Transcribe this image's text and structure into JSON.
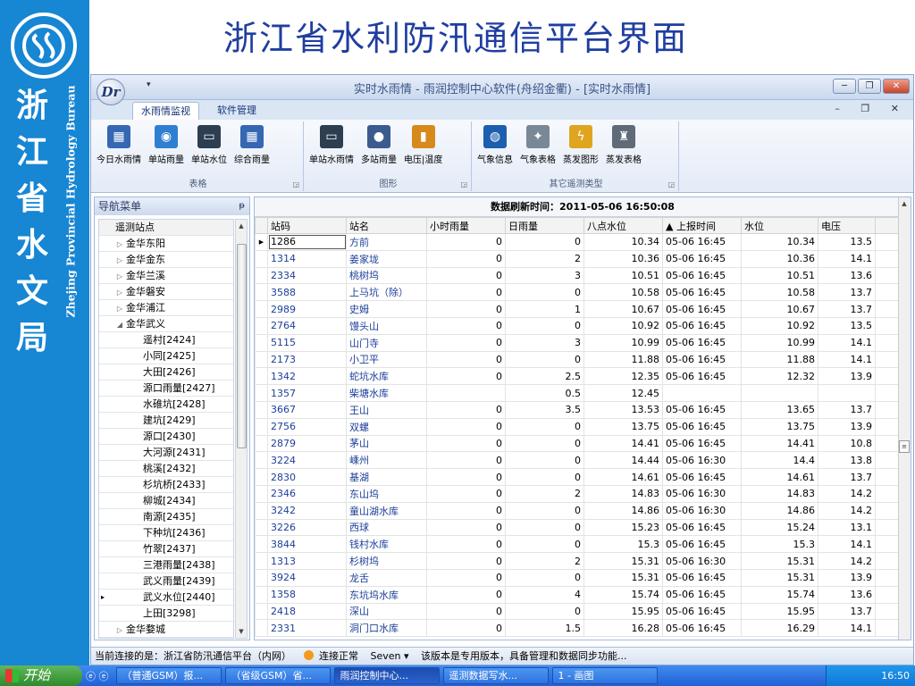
{
  "slide": {
    "title": "浙江省水利防汛通信平台界面",
    "org_cn": [
      "浙",
      "江",
      "省",
      "水",
      "文",
      "局"
    ],
    "org_en": "Zhejing Provincial Hydrology Bureau"
  },
  "window": {
    "title": "实时水雨情 - 雨润控制中心软件(舟绍金衢) - [实时水雨情]",
    "app_icon_text": "Dr",
    "qat": "▾",
    "btn_min": "─",
    "btn_max": "❐",
    "btn_close": "✕"
  },
  "ribbon": {
    "tabs": [
      "水雨情监视",
      "软件管理"
    ],
    "mdi_buttons": "– ❐ ✕",
    "groups": [
      {
        "label": "表格",
        "buttons": [
          {
            "label": "今日水雨情",
            "icon": "grid-table-icon",
            "color": "#3567b3",
            "glyph": "▦"
          },
          {
            "label": "单站雨量",
            "icon": "rain-gauge-icon",
            "color": "#2f7fd1",
            "glyph": "◉"
          },
          {
            "label": "单站水位",
            "icon": "water-level-monitor-icon",
            "color": "#2c3e50",
            "glyph": "▭"
          },
          {
            "label": "综合雨量",
            "icon": "grid-table-icon",
            "color": "#3567b3",
            "glyph": "▦"
          }
        ]
      },
      {
        "label": "图形",
        "buttons": [
          {
            "label": "单站水雨情",
            "icon": "chart-monitor-icon",
            "color": "#2c3e50",
            "glyph": "▭"
          },
          {
            "label": "多站雨量",
            "icon": "globe-icon",
            "color": "#3b5b8f",
            "glyph": "●"
          },
          {
            "label": "电压|温度",
            "icon": "battery-icon",
            "color": "#d68a1c",
            "glyph": "▮"
          }
        ]
      },
      {
        "label": "其它遥测类型",
        "buttons": [
          {
            "label": "气象信息",
            "icon": "weather-globe-icon",
            "color": "#1c5fae",
            "glyph": "◍"
          },
          {
            "label": "气象表格",
            "icon": "weather-station-icon",
            "color": "#7a8796",
            "glyph": "✦"
          },
          {
            "label": "蒸发图形",
            "icon": "evaporation-lightning-icon",
            "color": "#e0a51f",
            "glyph": "ϟ"
          },
          {
            "label": "蒸发表格",
            "icon": "evaporation-gauge-icon",
            "color": "#5f6b78",
            "glyph": "♜"
          }
        ]
      }
    ]
  },
  "nav": {
    "title": "导航菜单",
    "pin": "ᵽ",
    "root": "遥测站点",
    "items": [
      {
        "label": "金华东阳",
        "level": 1,
        "expander": "▷"
      },
      {
        "label": "金华金东",
        "level": 1,
        "expander": "▷"
      },
      {
        "label": "金华兰溪",
        "level": 1,
        "expander": "▷"
      },
      {
        "label": "金华磐安",
        "level": 1,
        "expander": "▷"
      },
      {
        "label": "金华浦江",
        "level": 1,
        "expander": "▷"
      },
      {
        "label": "金华武义",
        "level": 1,
        "expander": "◢"
      },
      {
        "label": "遥村[2424]",
        "level": 2
      },
      {
        "label": "小同[2425]",
        "level": 2
      },
      {
        "label": "大田[2426]",
        "level": 2
      },
      {
        "label": "源口雨量[2427]",
        "level": 2
      },
      {
        "label": "水碓坑[2428]",
        "level": 2
      },
      {
        "label": "建坑[2429]",
        "level": 2
      },
      {
        "label": "源口[2430]",
        "level": 2
      },
      {
        "label": "大河源[2431]",
        "level": 2
      },
      {
        "label": "桃溪[2432]",
        "level": 2
      },
      {
        "label": "杉坑桥[2433]",
        "level": 2
      },
      {
        "label": "柳城[2434]",
        "level": 2
      },
      {
        "label": "南源[2435]",
        "level": 2
      },
      {
        "label": "下种坑[2436]",
        "level": 2
      },
      {
        "label": "竹翠[2437]",
        "level": 2
      },
      {
        "label": "三港雨量[2438]",
        "level": 2
      },
      {
        "label": "武义雨量[2439]",
        "level": 2
      },
      {
        "label": "武义水位[2440]",
        "level": 2,
        "marker": "▸"
      },
      {
        "label": "上田[3298]",
        "level": 2
      },
      {
        "label": "金华婺城",
        "level": 1,
        "expander": "▷"
      }
    ]
  },
  "grid": {
    "refresh_text": "数据刷新时间：2011-05-06 16:50:08",
    "columns": [
      "站码",
      "站名",
      "小时雨量",
      "日雨量",
      "八点水位",
      "▲  上报时间",
      "水位",
      "电压"
    ],
    "current_marker": "▶",
    "rows": [
      [
        "1286",
        "方前",
        "0",
        "0",
        "10.34",
        "05-06 16:45",
        "10.34",
        "13.5"
      ],
      [
        "1314",
        "姜家垅",
        "0",
        "2",
        "10.36",
        "05-06 16:45",
        "10.36",
        "14.1"
      ],
      [
        "2334",
        "桃树坞",
        "0",
        "3",
        "10.51",
        "05-06 16:45",
        "10.51",
        "13.6"
      ],
      [
        "3588",
        "上马坑（除）",
        "0",
        "0",
        "10.58",
        "05-06 16:45",
        "10.58",
        "13.7"
      ],
      [
        "2989",
        "史姆",
        "0",
        "1",
        "10.67",
        "05-06 16:45",
        "10.67",
        "13.7"
      ],
      [
        "2764",
        "馒头山",
        "0",
        "0",
        "10.92",
        "05-06 16:45",
        "10.92",
        "13.5"
      ],
      [
        "5115",
        "山门寺",
        "0",
        "3",
        "10.99",
        "05-06 16:45",
        "10.99",
        "14.1"
      ],
      [
        "2173",
        "小卫平",
        "0",
        "0",
        "11.88",
        "05-06 16:45",
        "11.88",
        "14.1"
      ],
      [
        "1342",
        "蛇坑水库",
        "0",
        "2.5",
        "12.35",
        "05-06 16:45",
        "12.32",
        "13.9"
      ],
      [
        "1357",
        "柴塘水库",
        "",
        "0.5",
        "12.45",
        "",
        "",
        ""
      ],
      [
        "3667",
        "王山",
        "0",
        "3.5",
        "13.53",
        "05-06 16:45",
        "13.65",
        "13.7"
      ],
      [
        "2756",
        "双螺",
        "0",
        "0",
        "13.75",
        "05-06 16:45",
        "13.75",
        "13.9"
      ],
      [
        "2879",
        "茅山",
        "0",
        "0",
        "14.41",
        "05-06 16:45",
        "14.41",
        "10.8"
      ],
      [
        "3224",
        "嵊州",
        "0",
        "0",
        "14.44",
        "05-06 16:30",
        "14.4",
        "13.8"
      ],
      [
        "2830",
        "基湖",
        "0",
        "0",
        "14.61",
        "05-06 16:45",
        "14.61",
        "13.7"
      ],
      [
        "2346",
        "东山坞",
        "0",
        "2",
        "14.83",
        "05-06 16:30",
        "14.83",
        "14.2"
      ],
      [
        "3242",
        "童山湖水库",
        "0",
        "0",
        "14.86",
        "05-06 16:30",
        "14.86",
        "14.2"
      ],
      [
        "3226",
        "西球",
        "0",
        "0",
        "15.23",
        "05-06 16:45",
        "15.24",
        "13.1"
      ],
      [
        "3844",
        "钱村水库",
        "0",
        "0",
        "15.3",
        "05-06 16:45",
        "15.3",
        "14.1"
      ],
      [
        "1313",
        "杉树坞",
        "0",
        "2",
        "15.31",
        "05-06 16:30",
        "15.31",
        "14.2"
      ],
      [
        "3924",
        "龙舌",
        "0",
        "0",
        "15.31",
        "05-06 16:45",
        "15.31",
        "13.9"
      ],
      [
        "1358",
        "东坑坞水库",
        "0",
        "4",
        "15.74",
        "05-06 16:45",
        "15.74",
        "13.6"
      ],
      [
        "2418",
        "深山",
        "0",
        "0",
        "15.95",
        "05-06 16:45",
        "15.95",
        "13.7"
      ],
      [
        "2331",
        "洞门口水库",
        "0",
        "1.5",
        "16.28",
        "05-06 16:45",
        "16.29",
        "14.1"
      ]
    ]
  },
  "status": {
    "prefix": "当前连接的是：浙江省防汛通信平台（内网）",
    "connection": "连接正常",
    "user": "Seven ▾",
    "notice": "该版本是专用版本，具备管理和数据同步功能..."
  },
  "taskbar": {
    "start": "开始",
    "quick": "ⓔ ⓔ",
    "tasks": [
      "（普通GSM）报...",
      "（省级GSM）省...",
      "雨润控制中心...",
      "遥测数据写水...",
      "1 - 画图"
    ],
    "active_task": 2,
    "time": "16:50"
  }
}
